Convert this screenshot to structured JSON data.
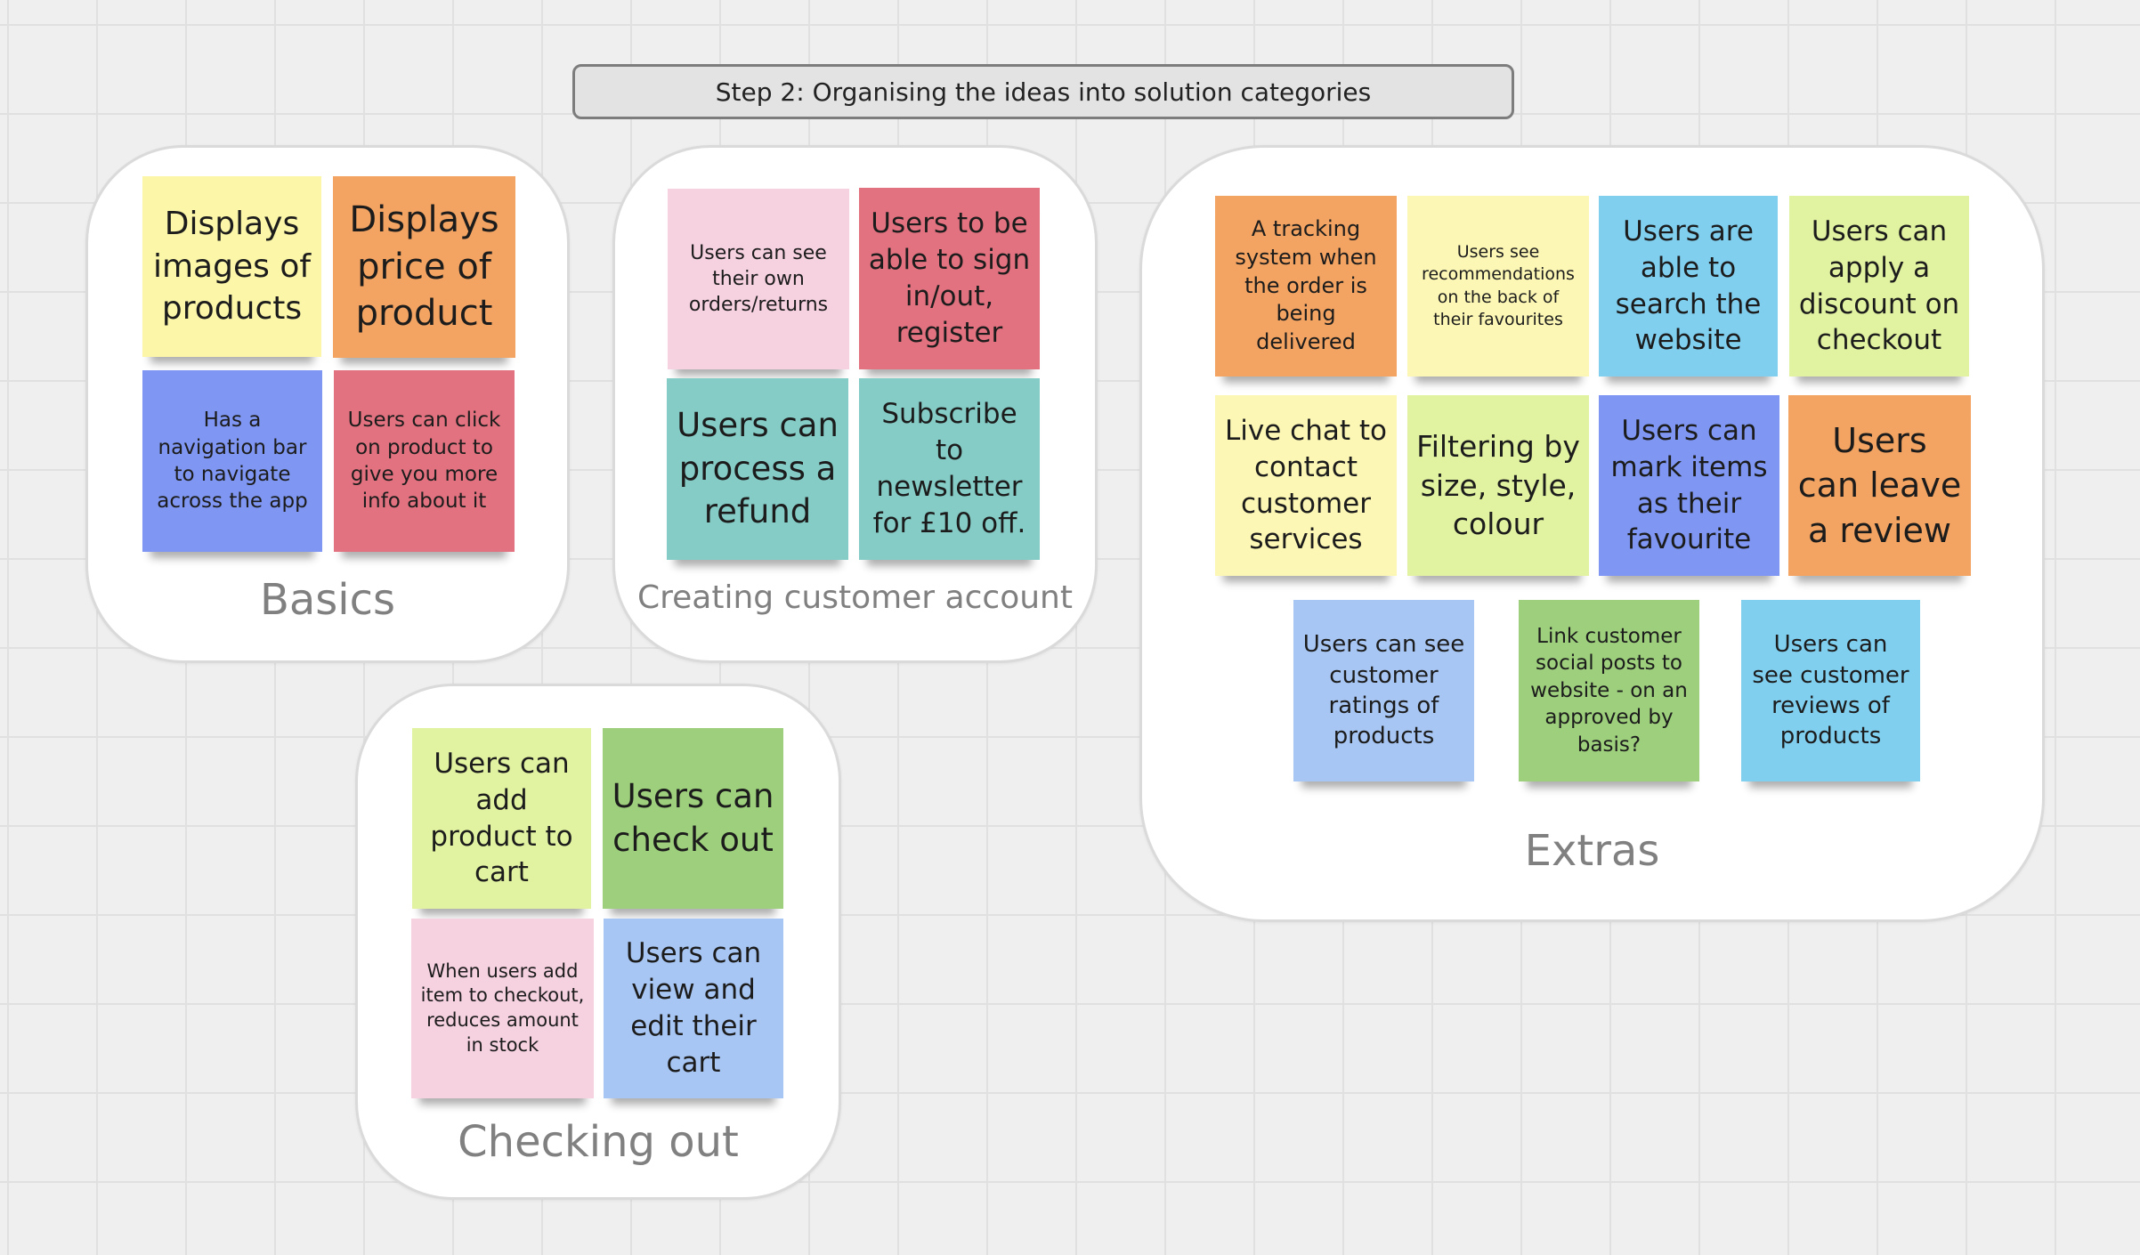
{
  "title": "Step 2: Organising the ideas into solution categories",
  "colors": {
    "yellow": "#fbf6a8",
    "orange": "#f3a462",
    "blue": "#7f97f2",
    "red": "#e2727f",
    "pink": "#f6d1e0",
    "teal": "#85ccc6",
    "light_yellow": "#fcf7b4",
    "cyan": "#80cfef",
    "lime": "#e1f3a1",
    "green": "#9dcf7c",
    "light_blue": "#a8c6f3"
  },
  "categories": {
    "basics": {
      "label": "Basics",
      "notes": [
        "Displays images of products",
        "Displays price of product",
        "Has a navigation bar to navigate across the app",
        "Users can click on product to give you more info about it"
      ]
    },
    "account": {
      "label": "Creating customer account",
      "notes": [
        "Users can see their own orders/returns",
        "Users to be able to sign in/out, register",
        "Users can process a refund",
        "Subscribe to newsletter for £10 off."
      ]
    },
    "extras": {
      "label": "Extras",
      "notes": [
        "A tracking system when the order is being delivered",
        "Users see recommendations on the back of their favourites",
        "Users are able to search the website",
        "Users can apply a discount on checkout",
        "Live chat to contact customer services",
        "Filtering by size, style, colour",
        "Users can mark items as their favourite",
        "Users can leave a review",
        "Users can see customer ratings of products",
        "Link customer social posts to website - on an approved by basis?",
        "Users can see customer reviews of products"
      ]
    },
    "checkout": {
      "label": "Checking out",
      "notes": [
        "Users can add product to cart",
        "Users can check out",
        "When users add item to checkout, reduces amount in stock",
        "Users can view and edit their cart"
      ]
    }
  }
}
